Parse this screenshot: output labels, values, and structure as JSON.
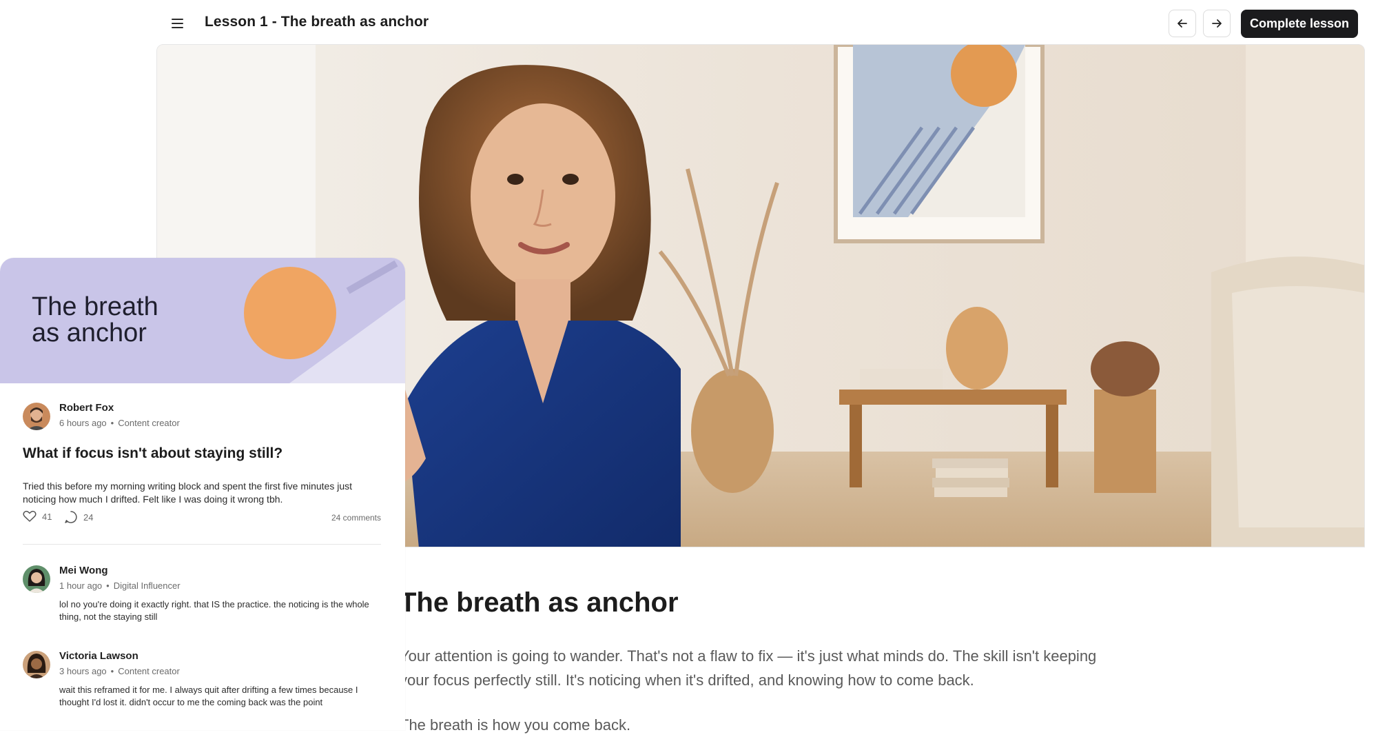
{
  "header": {
    "lesson_title": "Lesson 1 - The breath as anchor",
    "complete_label": "Complete lesson",
    "icons": {
      "menu": "hamburger-menu-icon",
      "prev": "arrow-left-icon",
      "next": "arrow-right-icon"
    }
  },
  "lesson": {
    "heading": "The breath as anchor",
    "paragraph_1": "Your attention is going to wander. That's not a flaw to fix — it's just what minds do. The skill isn't keeping your focus perfectly still. It's noticing when it's drifted, and knowing how to come back.",
    "paragraph_2": "The breath is how you come back."
  },
  "card": {
    "banner_line_1": "The breath",
    "banner_line_2": "as anchor",
    "banner_colors": {
      "lavender": "#c9c5e8",
      "light": "#e3e1f3",
      "orange": "#f0a562"
    },
    "post": {
      "author": "Robert Fox",
      "time": "6 hours ago",
      "role": "Content creator",
      "title": "What if focus isn't about staying still?",
      "body": "Tried this before my morning writing block and spent the first five minutes just noticing how much I drifted. Felt like I was doing it wrong tbh.",
      "likes": "41",
      "replies": "24",
      "comments_label": "24 comments"
    },
    "comments": [
      {
        "author": "Mei Wong",
        "time": "1 hour ago",
        "role": "Digital Influencer",
        "text": "lol no you're doing it exactly right. that IS the practice. the noticing is the whole thing, not the staying still"
      },
      {
        "author": "Victoria Lawson",
        "time": "3 hours ago",
        "role": "Content creator",
        "text": "wait this reframed it for me. I always quit after drifting a few times because I thought I'd lost it. didn't occur to me the coming back was the point"
      }
    ]
  },
  "colors": {
    "primary_button": "#1b1b1d",
    "text_muted": "#5a5a5a"
  }
}
